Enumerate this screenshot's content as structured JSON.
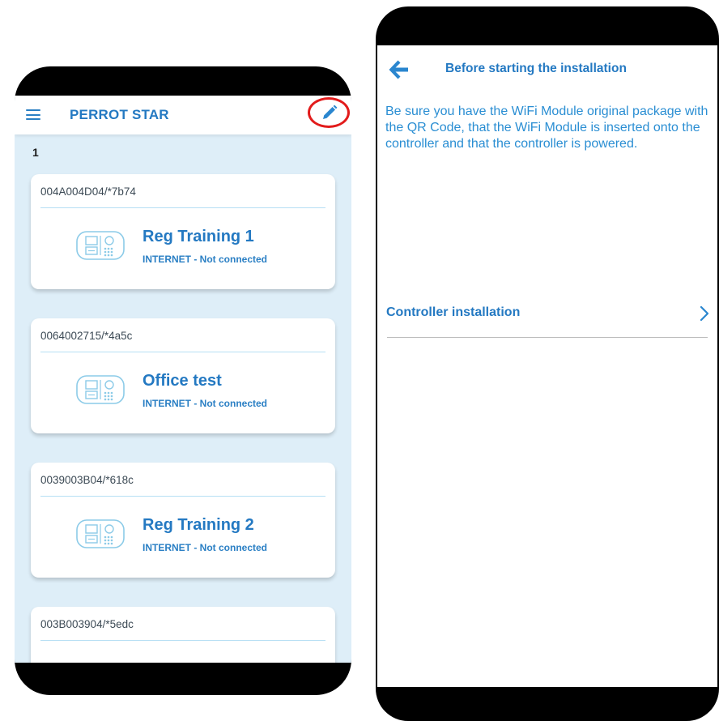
{
  "left_screen": {
    "header": {
      "app_title": "PERROT STAR",
      "menu_icon": "hamburger-menu-icon",
      "edit_icon": "pencil-edit-icon"
    },
    "list_count": "1",
    "devices": [
      {
        "id": "004A004D04/*7b74",
        "name": "Reg Training 1",
        "status": "INTERNET - Not connected"
      },
      {
        "id": "0064002715/*4a5c",
        "name": "Office test",
        "status": "INTERNET - Not connected"
      },
      {
        "id": "0039003B04/*618c",
        "name": "Reg Training 2",
        "status": "INTERNET - Not connected"
      },
      {
        "id": "003B003904/*5edc"
      }
    ]
  },
  "right_screen": {
    "back_icon": "arrow-left-icon",
    "title": "Before starting the installation",
    "description": "Be sure you have the WiFi Module original package with the QR Code, that the WiFi Module is inserted onto the controller and that the controller is powered.",
    "installation_item": {
      "label": "Controller installation",
      "icon": "chevron-right-icon"
    }
  },
  "colors": {
    "brand_blue": "#2479c2",
    "text_blue": "#2a8ed3",
    "list_background": "#deeef8",
    "highlight_red": "#e21b1b",
    "icon_light_blue": "#8ccbe8"
  }
}
